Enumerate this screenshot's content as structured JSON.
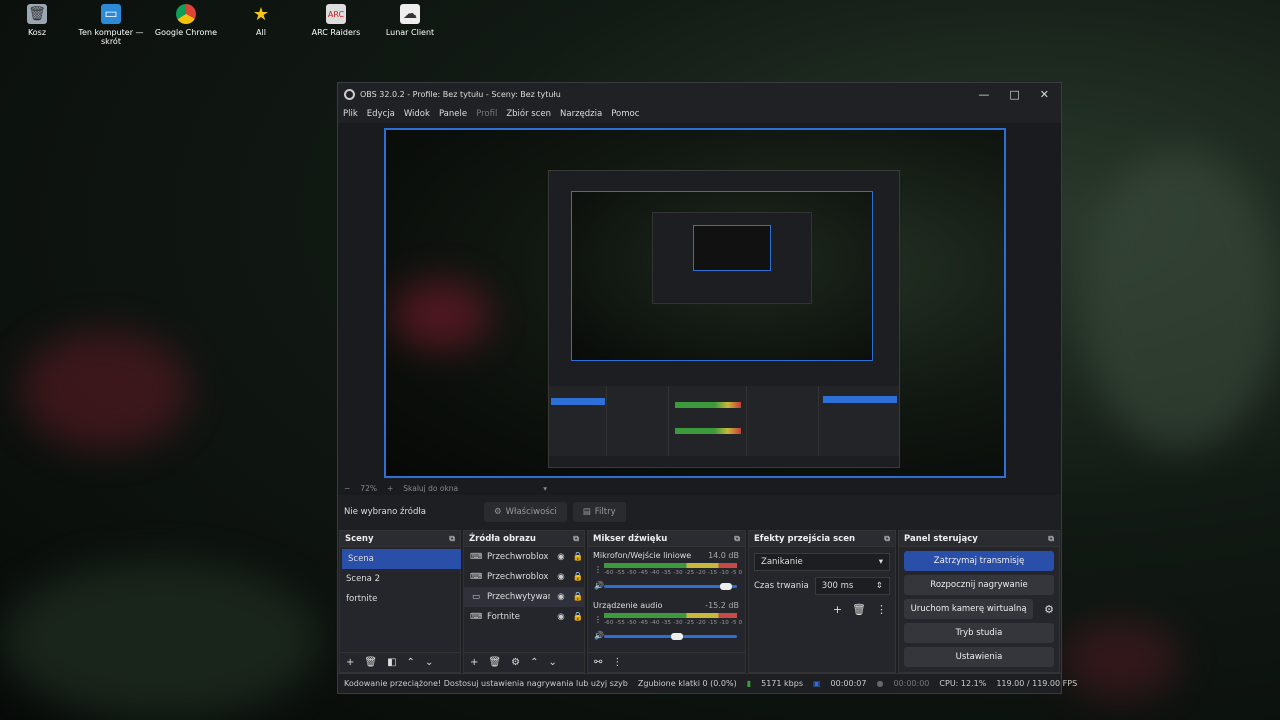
{
  "desktop": {
    "icons": [
      {
        "label": "Kosz",
        "icon": "recycle-bin-icon"
      },
      {
        "label": "Ten komputer — skrót",
        "icon": "computer-icon"
      },
      {
        "label": "Google Chrome",
        "icon": "chrome-icon"
      },
      {
        "label": "All",
        "icon": "star-icon"
      },
      {
        "label": "ARC Raiders",
        "icon": "arc-raiders-icon"
      },
      {
        "label": "Lunar Client",
        "icon": "lunar-client-icon"
      }
    ]
  },
  "window": {
    "title": "OBS 32.0.2 - Profile: Bez tytułu - Sceny: Bez tytułu",
    "controls": {
      "minimize": "—",
      "maximize": "□",
      "close": "✕"
    }
  },
  "menu": [
    "Plik",
    "Edycja",
    "Widok",
    "Panele",
    "Profil",
    "Zbiór scen",
    "Narzędzia",
    "Pomoc"
  ],
  "zoom": {
    "minus": "−",
    "value": "72%",
    "plus": "+",
    "mode": "Skaluj do okna"
  },
  "source_bar": {
    "no_source": "Nie wybrano źródła",
    "properties": "Właściwości",
    "filters": "Filtry"
  },
  "scenes": {
    "title": "Sceny",
    "items": [
      "Scena",
      "Scena 2",
      "fortnite"
    ],
    "selected": 0
  },
  "sources": {
    "title": "Źródła obrazu",
    "items": [
      {
        "name": "Przechwroblox",
        "icon": "gamepad-icon"
      },
      {
        "name": "Przechwroblox",
        "icon": "gamepad-icon"
      },
      {
        "name": "Przechwytywar",
        "icon": "monitor-icon"
      },
      {
        "name": "Fortnite",
        "icon": "gamepad-icon"
      }
    ]
  },
  "mixer": {
    "title": "Mikser dźwięku",
    "channels": [
      {
        "name": "Mikrofon/Wejście liniowe",
        "db": "14.0 dB",
        "volume": 0.92
      },
      {
        "name": "Urządzenie audio",
        "db": "-15.2 dB",
        "volume": 0.55
      }
    ],
    "ticks": "-60 -55 -50 -45 -40 -35 -30 -25 -20 -15 -10 -5 0"
  },
  "transitions": {
    "title": "Efekty przejścia scen",
    "selected": "Zanikanie",
    "duration_label": "Czas trwania",
    "duration_value": "300 ms"
  },
  "controls": {
    "title": "Panel sterujący",
    "stop_stream": "Zatrzymaj transmisję",
    "start_recording": "Rozpocznij nagrywanie",
    "virtual_camera": "Uruchom kamerę wirtualną",
    "studio_mode": "Tryb studia",
    "settings": "Ustawienia"
  },
  "status": {
    "message": "Kodowanie przeciążone! Dostosuj ustawienia nagrywania lub użyj szyb",
    "dropped": "Zgubione klatki 0 (0.0%)",
    "bitrate": "5171 kbps",
    "stream_time": "00:00:07",
    "rec_time": "00:00:00",
    "cpu": "CPU: 12.1%",
    "fps": "119.00 / 119.00 FPS"
  },
  "colors": {
    "accent": "#2a4fa8",
    "preview_border": "#2e6fd6"
  }
}
